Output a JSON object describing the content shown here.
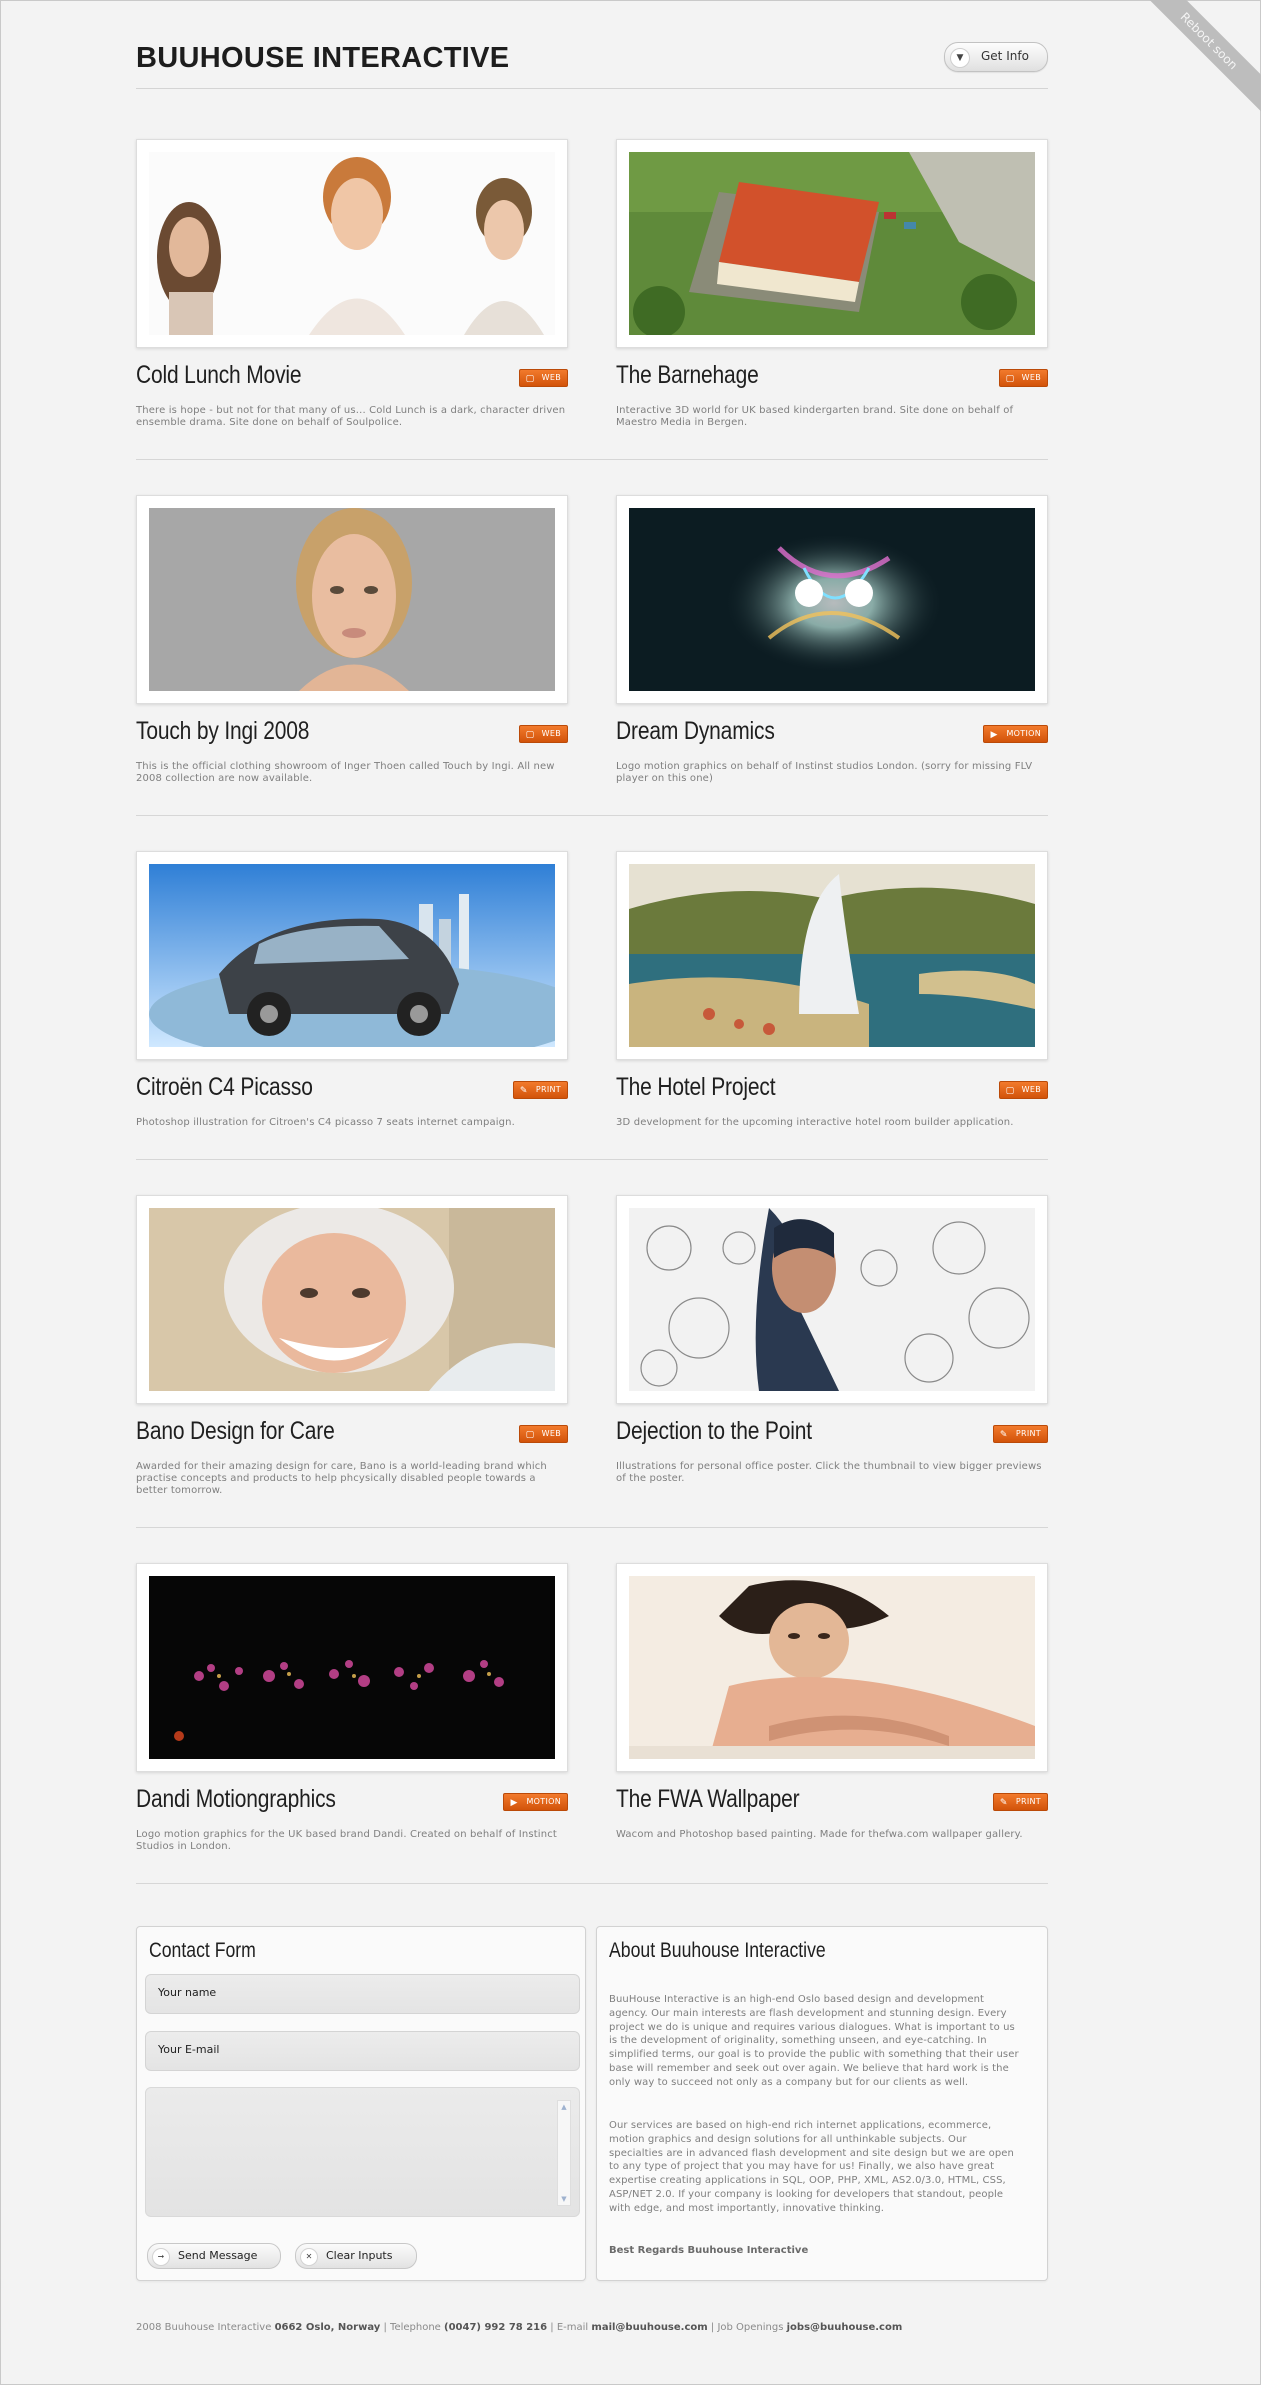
{
  "site": {
    "logo": "BUUHOUSE INTERACTIVE",
    "get_info_label": "Get Info",
    "ribbon": "Reboot soon"
  },
  "projects": [
    {
      "title": "Cold Lunch Movie",
      "badge": "WEB",
      "badge_icon": "monitor-icon",
      "description": "There is hope - but not for that many of us... Cold Lunch is a dark, character driven ensemble drama. Site done on behalf of Soulpolice."
    },
    {
      "title": "The Barnehage",
      "badge": "WEB",
      "badge_icon": "monitor-icon",
      "description": "Interactive 3D world for UK based kindergarten brand. Site done on behalf of Maestro Media in Bergen."
    },
    {
      "title": "Touch by Ingi 2008",
      "badge": "WEB",
      "badge_icon": "monitor-icon",
      "description": "This is the official clothing showroom of Inger Thoen called Touch by Ingi. All new 2008 collection are now available."
    },
    {
      "title": "Dream Dynamics",
      "badge": "MOTION",
      "badge_icon": "play-icon",
      "description": "Logo motion graphics on behalf of Instinst studios London. (sorry for missing FLV player on this one)"
    },
    {
      "title": "Citroën C4 Picasso",
      "badge": "PRINT",
      "badge_icon": "pencil-icon",
      "description": "Photoshop illustration for Citroen's C4 picasso 7 seats internet campaign."
    },
    {
      "title": "The Hotel Project",
      "badge": "WEB",
      "badge_icon": "monitor-icon",
      "description": "3D development for the upcoming interactive hotel room builder application."
    },
    {
      "title": "Bano Design for Care",
      "badge": "WEB",
      "badge_icon": "monitor-icon",
      "description": "Awarded for their amazing design for care, Bano is a world-leading brand which practise concepts and products to help phcysically disabled people towards a better tomorrow."
    },
    {
      "title": "Dejection to the Point",
      "badge": "PRINT",
      "badge_icon": "pencil-icon",
      "description": "Illustrations for personal office poster. Click the thumbnail to view bigger previews of the poster."
    },
    {
      "title": "Dandi Motiongraphics",
      "badge": "MOTION",
      "badge_icon": "play-icon",
      "description": "Logo motion graphics for the UK based brand Dandi. Created on behalf of Instinct Studios in London."
    },
    {
      "title": "The FWA Wallpaper",
      "badge": "PRINT",
      "badge_icon": "pencil-icon",
      "description": "Wacom and Photoshop based painting. Made for thefwa.com wallpaper gallery."
    }
  ],
  "contact": {
    "title": "Contact Form",
    "name_value": "Your name",
    "email_value": "Your E-mail",
    "send_label": "Send Message",
    "clear_label": "Clear Inputs"
  },
  "about": {
    "title": "About Buuhouse Interactive",
    "paragraph1": "BuuHouse Interactive is an high-end Oslo based design and development agency. Our main interests are flash development and stunning design. Every project we do is unique and requires various dialogues. What is important to us is the development of originality, something unseen, and eye-catching. In simplified terms, our goal is to provide the public with something that their user base will remember and seek out over again. We believe that hard work is the only way to succeed not only as a company but for our clients as well.",
    "paragraph2": "Our services are based on high-end rich internet applications, ecommerce, motion graphics and design solutions for all unthinkable subjects. Our specialties are in advanced flash development and site design but we are open to any type of project that you may have for us! Finally, we also have great expertise creating applications in SQL, OOP, PHP, XML, AS2.0/3.0, HTML, CSS, ASP/NET 2.0. If your company is looking for developers that standout, people with edge, and most importantly, innovative thinking.",
    "signature": "Best Regards Buuhouse Interactive"
  },
  "footer": {
    "company": "2008 Buuhouse Interactive",
    "address": "0662 Oslo, Norway",
    "phone_label": "Telephone",
    "phone": "(0047) 992 78 216",
    "email_label": "E-mail",
    "email": "mail@buuhouse.com",
    "jobs_label": "Job Openings",
    "jobs_email": "jobs@buuhouse.com",
    "separator": "|"
  }
}
